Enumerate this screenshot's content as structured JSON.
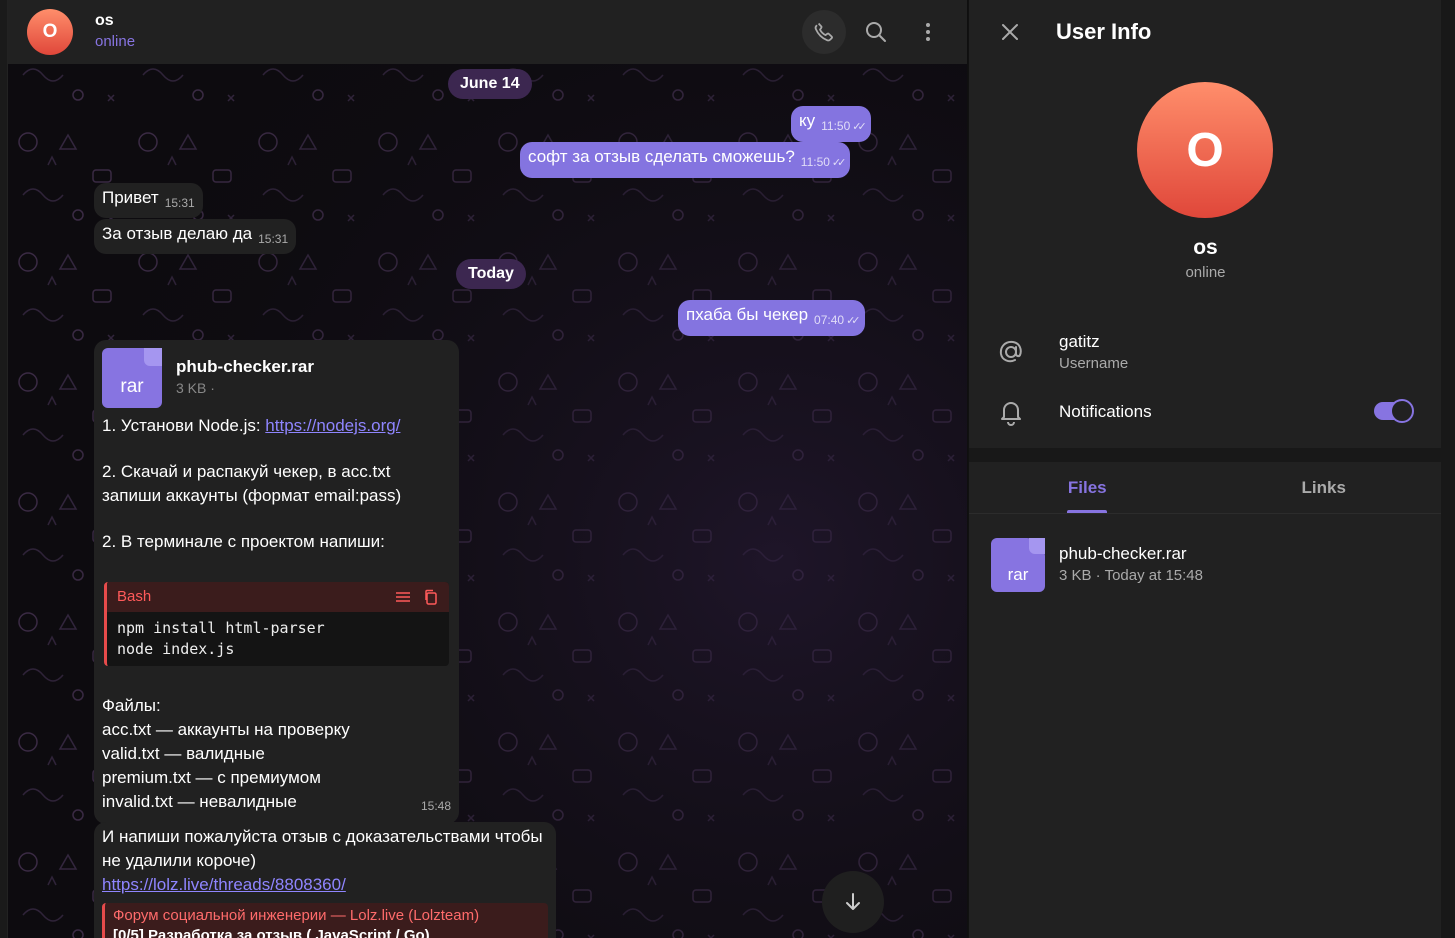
{
  "chat": {
    "peer_initial": "O",
    "peer_name": "os",
    "peer_status": "online",
    "dates": [
      "June 14",
      "Today"
    ],
    "messages": [
      {
        "text": "ку",
        "time": "11:50"
      },
      {
        "text": "софт за отзыв сделать сможешь?",
        "time": "11:50"
      },
      {
        "text": "Привет",
        "time": "15:31"
      },
      {
        "text": "За отзыв делаю да",
        "time": "15:31"
      },
      {
        "text": "пхаба бы чекер",
        "time": "07:40"
      }
    ],
    "file_message": {
      "icon_label": "rar",
      "file_name": "phub-checker.rar",
      "file_size": "3 KB ·",
      "line1_prefix": "1. Установи Node.js: ",
      "line1_link": "https://nodejs.org/",
      "para2": "2. Скачай и распакуй чекер, в acc.txt запиши аккаунты (формат email:pass)",
      "para3": "2. В терминале с проектом напиши:",
      "code_lang": "Bash",
      "code": "npm install html-parser\nnode index.js",
      "files_header": "Файлы:",
      "files_lines": [
        "acc.txt — аккаунты на проверку",
        "valid.txt — валидные",
        "premium.txt — с премиумом",
        "invalid.txt — невалидные"
      ],
      "time": "15:48"
    },
    "last_message": {
      "text": "И напиши пожалуйста отзыв с доказательствами чтобы не удалили короче)",
      "link": "https://lolz.live/threads/8808360/",
      "preview_site": "Форум социальной инженерии — Lolz.live (Lolzteam)",
      "preview_title": "[0/5] Разработка за отзыв ( JavaScript / Go)"
    }
  },
  "panel": {
    "title": "User Info",
    "avatar_initial": "O",
    "name": "os",
    "status": "online",
    "username": "gatitz",
    "username_label": "Username",
    "notifications_label": "Notifications",
    "notifications_on": true,
    "tabs": [
      "Files",
      "Links"
    ],
    "active_tab": "Files",
    "file": {
      "icon_label": "rar",
      "name": "phub-checker.rar",
      "meta": "3 KB · Today at 15:48"
    }
  },
  "colors": {
    "accent": "#8774e1",
    "outgoing_bubble": "#8474e0",
    "incoming_bubble": "#212121",
    "date_pill": "#3c2750",
    "avatar": "#f06a4f",
    "code_accent": "#e64b4b"
  }
}
